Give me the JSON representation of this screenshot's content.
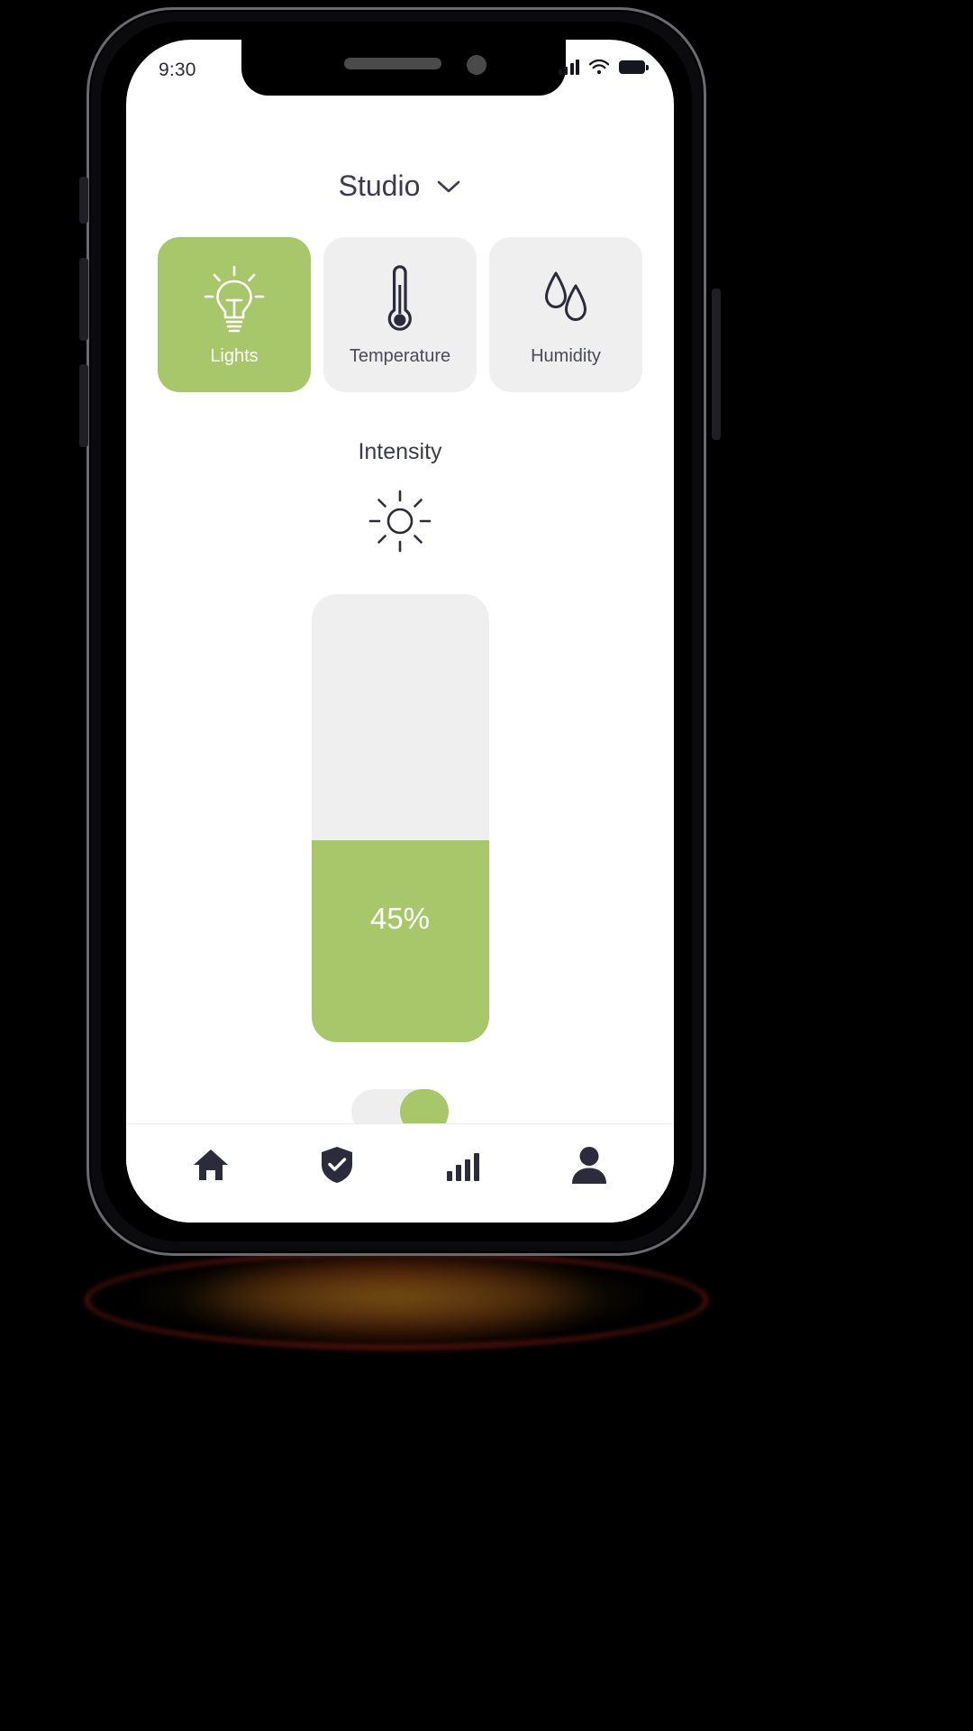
{
  "statusbar": {
    "time": "9:30",
    "signal_icon": "cellular-signal-icon",
    "wifi_icon": "wifi-icon",
    "battery_icon": "battery-full-icon"
  },
  "header": {
    "title": "Studio",
    "chevron_icon": "chevron-down-icon"
  },
  "cards": [
    {
      "label": "Lights",
      "icon": "lightbulb-icon",
      "active": true,
      "bg": "#a8c76b",
      "fg": "#ffffff"
    },
    {
      "label": "Temperature",
      "icon": "thermometer-icon",
      "active": false,
      "bg": "#efefef",
      "fg": "#4a4a5c"
    },
    {
      "label": "Humidity",
      "icon": "water-drops-icon",
      "active": false,
      "bg": "#efefef",
      "fg": "#4a4a5c"
    }
  ],
  "intensity": {
    "title": "Intensity",
    "icon": "sun-brightness-icon",
    "value_label": "45%",
    "percent": 45,
    "track_color": "#efefef",
    "fill_color": "#a8c76b"
  },
  "power_toggle": {
    "state": "on",
    "track_color": "#eeeeee",
    "knob_color": "#a8c76b"
  },
  "bottom_nav": [
    {
      "label": "Home",
      "icon": "home-icon"
    },
    {
      "label": "Security",
      "icon": "shield-check-icon"
    },
    {
      "label": "Stats",
      "icon": "bar-chart-icon"
    },
    {
      "label": "Profile",
      "icon": "person-icon"
    }
  ],
  "theme": {
    "accent": "#a8c76b",
    "dark_text": "#3b3b4d",
    "muted_surface": "#efefef"
  }
}
